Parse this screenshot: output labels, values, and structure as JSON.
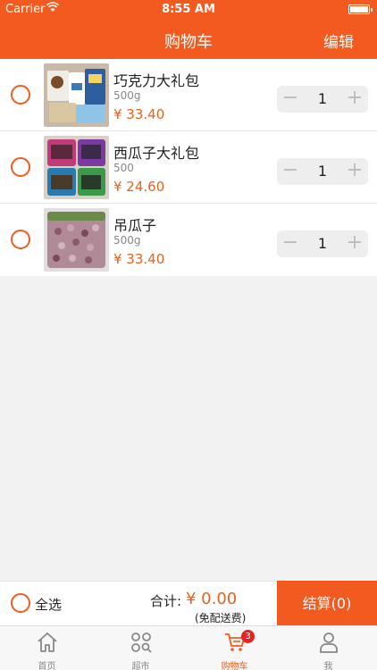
{
  "status_bar": {
    "carrier": "Carrier",
    "time": "8:55 AM"
  },
  "nav": {
    "title": "购物车",
    "edit_label": "编辑"
  },
  "cart_items": [
    {
      "name": "巧克力大礼包",
      "spec": "500g",
      "price": "¥ 33.40",
      "quantity": "1",
      "minus": "−",
      "plus": "+"
    },
    {
      "name": "西瓜子大礼包",
      "spec": "500",
      "price": "¥ 24.60",
      "quantity": "1",
      "minus": "−",
      "plus": "+"
    },
    {
      "name": "吊瓜子",
      "spec": "500g",
      "price": "¥ 33.40",
      "quantity": "1",
      "minus": "−",
      "plus": "+"
    }
  ],
  "checkout": {
    "select_all_label": "全选",
    "total_label": "合计:",
    "total_value": "¥ 0.00",
    "shipping_note": "(免配送费)",
    "pay_label": "结算(0)"
  },
  "tabs": [
    {
      "label": "首页",
      "icon": "home-icon"
    },
    {
      "label": "超市",
      "icon": "grid-icon"
    },
    {
      "label": "购物车",
      "icon": "cart-icon",
      "badge": "3",
      "active": true
    },
    {
      "label": "我",
      "icon": "user-icon"
    }
  ],
  "colors": {
    "accent": "#f35a1f",
    "price": "#e6621f",
    "badge": "#e8221f"
  }
}
